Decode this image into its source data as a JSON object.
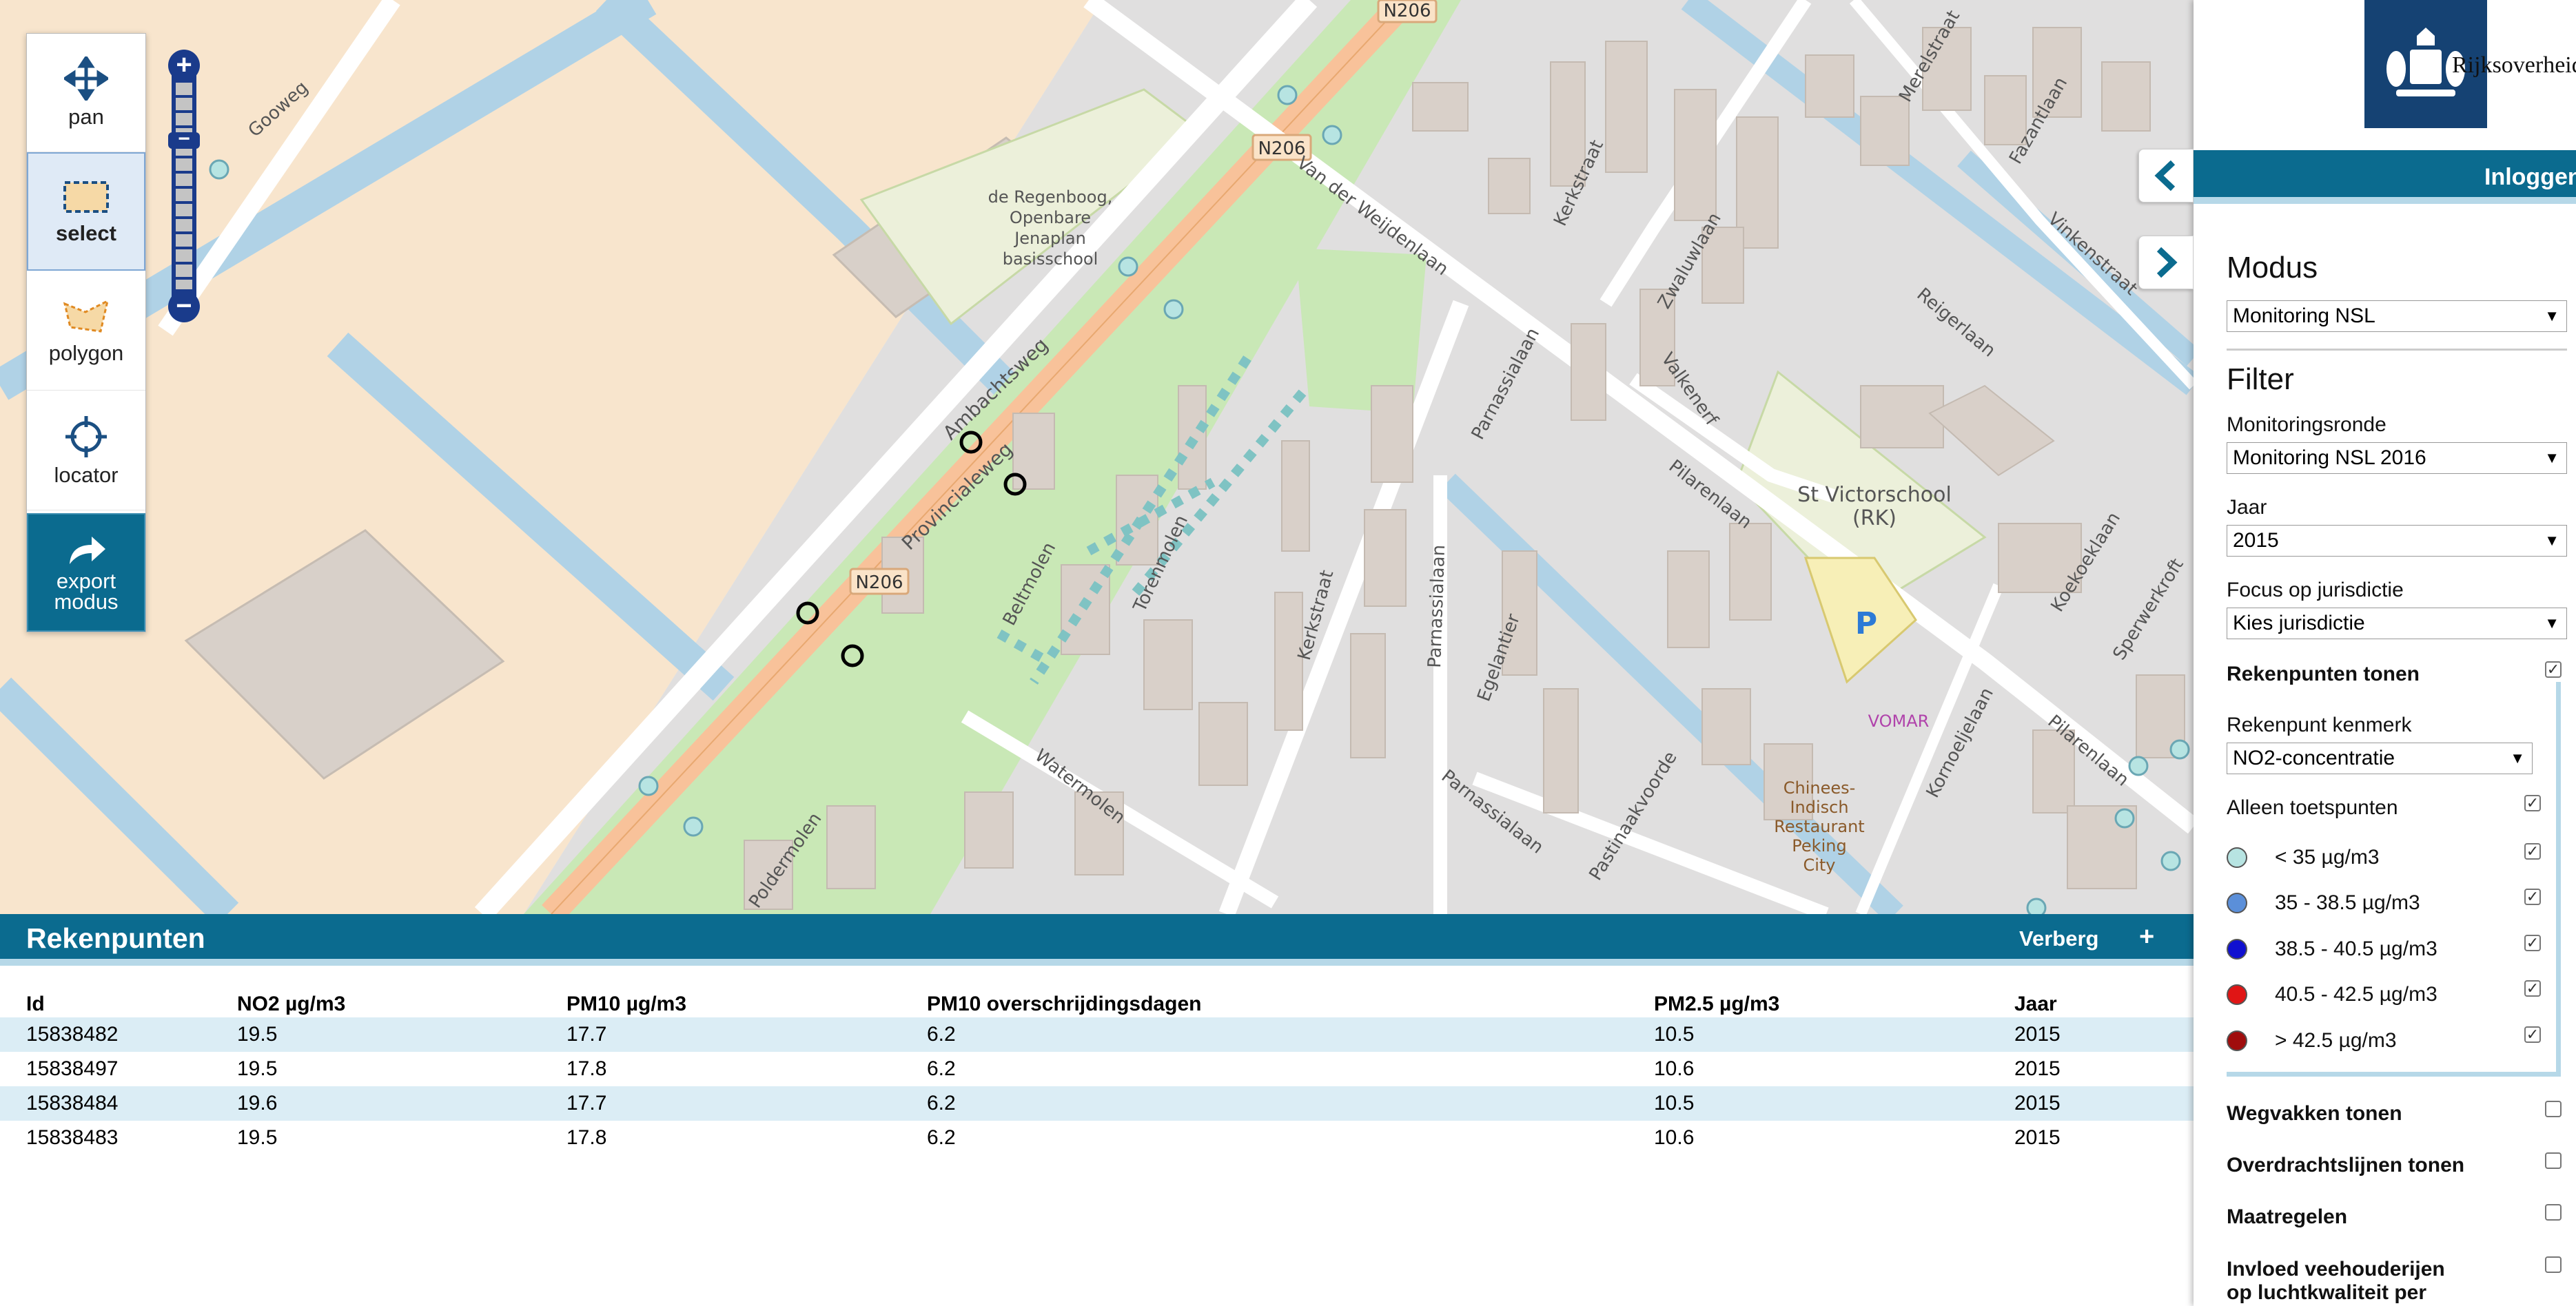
{
  "tools": {
    "pan": "pan",
    "select": "select",
    "polygon": "polygon",
    "locator": "locator",
    "export": "export modus"
  },
  "zoom": {
    "in": "+",
    "out": "−"
  },
  "map_labels": {
    "gooweg": "Gooweg",
    "ambachtsweg": "Ambachtsweg",
    "provincialeweg": "Provincialeweg",
    "n206_a": "N206",
    "n206_b": "N206",
    "n206_c": "N206",
    "school_1": "de Regenboog,",
    "school_2": "Openbare",
    "school_3": "Jenaplan",
    "school_4": "basisschool",
    "vdweijden": "Van der Weijdenlaan",
    "kerkstraat_a": "Kerkstraat",
    "kerkstraat_b": "Kerkstraat",
    "zwaluwlaan": "Zwaluwlaan",
    "valkenerf": "Valkenerf",
    "reigerlaan": "Reigerlaan",
    "merelstraat": "Merelstraat",
    "fazantlaan": "Fazantlaan",
    "vinkenstraat": "Vinkenstraat",
    "pilarenlaan_a": "Pilarenlaan",
    "pilarenlaan_b": "Pilarenlaan",
    "parnassialaan_a": "Parnassialaan",
    "parnassialaan_b": "Parnassialaan",
    "parnassialaan_c": "Parnassialaan",
    "egelantier": "Egelantier",
    "torenmolen": "Torenmolen",
    "beltmolen": "Beltmolen",
    "watermolen": "Watermolen",
    "poldermolen": "Poldermolen",
    "pastinaakvoorde": "Pastinaakvoorde",
    "kornoeljelaan": "Kornoeljelaan",
    "koekoeklaan": "Koekoeklaan",
    "sperwerkroft": "Sperwerkroft",
    "stvictor_1": "St Victorschool",
    "stvictor_2": "(RK)",
    "vomar": "VOMAR",
    "chinees_1": "Chinees-",
    "chinees_2": "Indisch",
    "chinees_3": "Restaurant",
    "chinees_4": "Peking",
    "chinees_5": "City",
    "parking": "P"
  },
  "results": {
    "title": "Rekenpunten",
    "hide": "Verberg",
    "plus": "+",
    "columns": [
      "Id",
      "NO2 µg/m3",
      "PM10 µg/m3",
      "PM10 overschrijdingsdagen",
      "PM2.5 µg/m3",
      "Jaar"
    ],
    "rows": [
      [
        "15838482",
        "19.5",
        "17.7",
        "6.2",
        "10.5",
        "2015"
      ],
      [
        "15838497",
        "19.5",
        "17.8",
        "6.2",
        "10.6",
        "2015"
      ],
      [
        "15838484",
        "19.6",
        "17.7",
        "6.2",
        "10.5",
        "2015"
      ],
      [
        "15838483",
        "19.5",
        "17.8",
        "6.2",
        "10.6",
        "2015"
      ]
    ]
  },
  "sidebar": {
    "logo_text": "Rijksoverheid",
    "login": "Inloggen",
    "modus_title": "Modus",
    "modus_value": "Monitoring NSL",
    "filter_title": "Filter",
    "monitoringsronde_label": "Monitoringsronde",
    "monitoringsronde_value": "Monitoring NSL 2016",
    "jaar_label": "Jaar",
    "jaar_value": "2015",
    "focus_label": "Focus op jurisdictie",
    "focus_value": "Kies jurisdictie",
    "rekenpunten_tonen": "Rekenpunten tonen",
    "kenmerk_label": "Rekenpunt kenmerk",
    "kenmerk_value": "NO2-concentratie",
    "alleen_toets": "Alleen toetspunten",
    "legend": [
      {
        "label": "< 35 µg/m3",
        "color": "#b7e4e2"
      },
      {
        "label": "35 - 38.5 µg/m3",
        "color": "#5b8fd9"
      },
      {
        "label": "38.5 - 40.5 µg/m3",
        "color": "#1010d0"
      },
      {
        "label": "40.5 - 42.5 µg/m3",
        "color": "#e01515"
      },
      {
        "label": "> 42.5 µg/m3",
        "color": "#a00d0d"
      }
    ],
    "wegvakken": "Wegvakken tonen",
    "overdracht": "Overdrachtslijnen tonen",
    "maatregelen": "Maatregelen",
    "invloed_1": "Invloed veehouderijen",
    "invloed_2": "op luchtkwaliteit per"
  },
  "colors": {
    "brand": "#0b6b8f",
    "accent_light": "#b6d8e8",
    "row_stripe": "#dbedf5",
    "logo": "#154273"
  }
}
